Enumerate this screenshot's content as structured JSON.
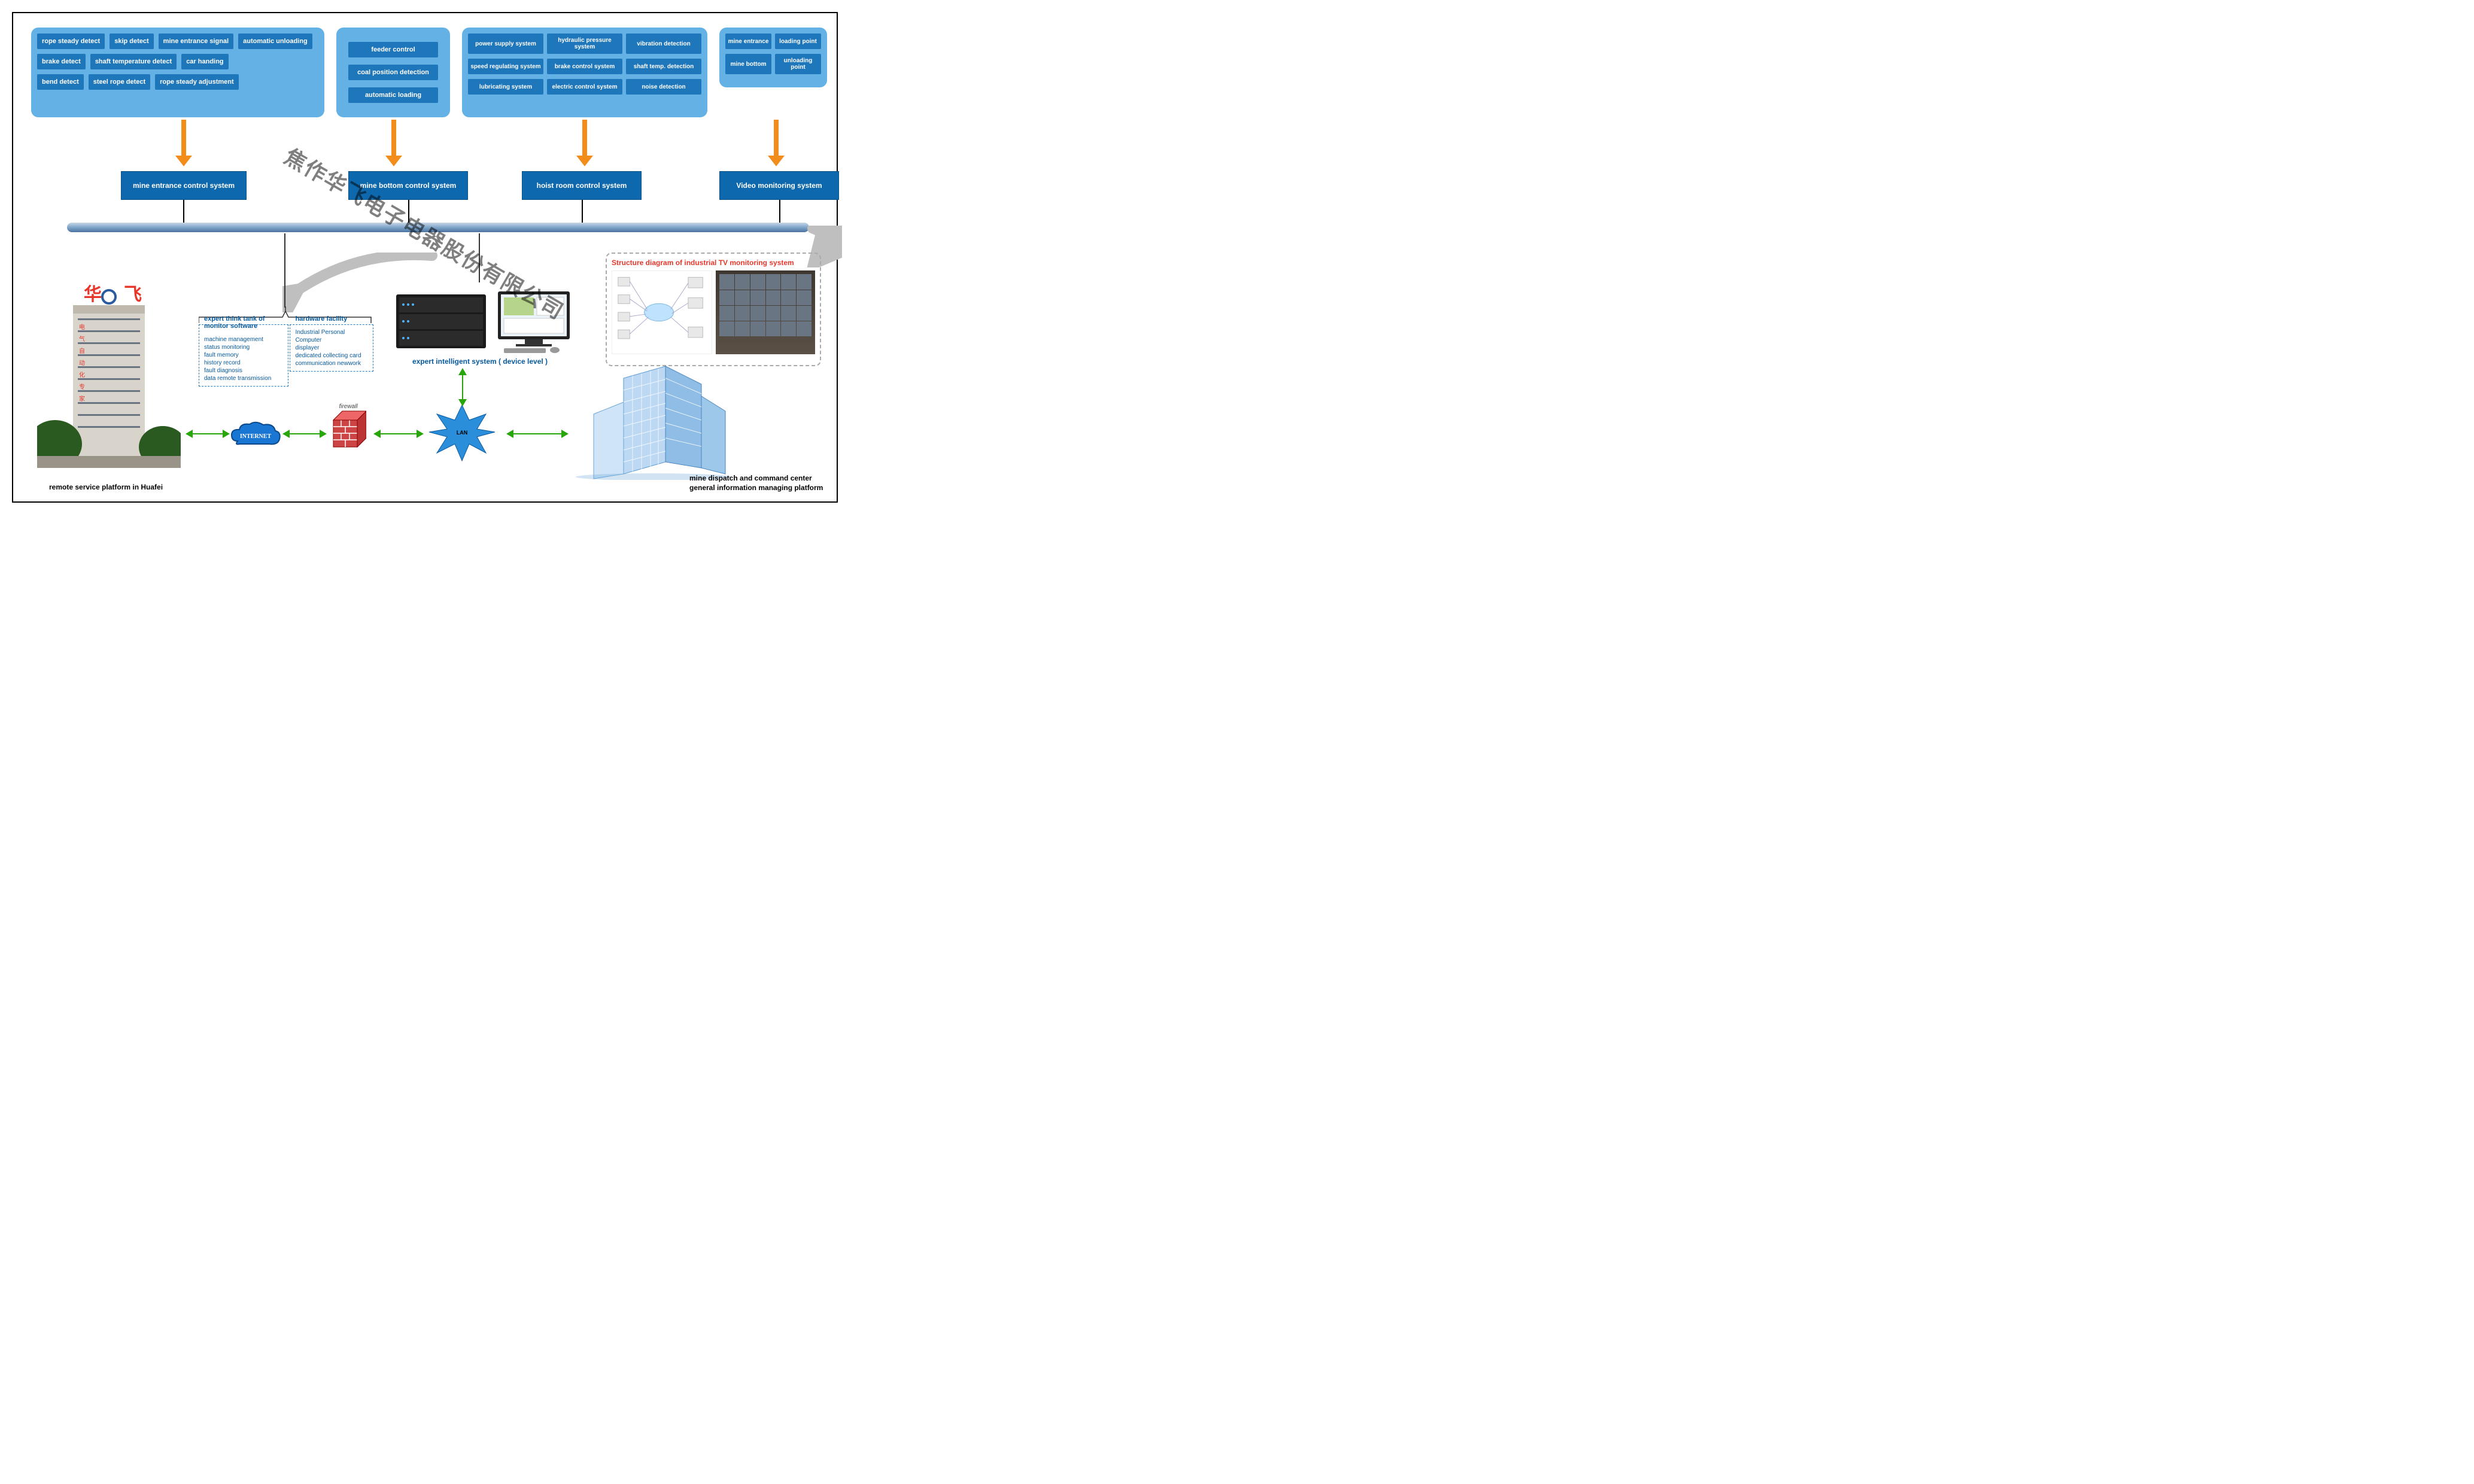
{
  "panel1": {
    "row1": [
      "rope steady detect",
      "skip detect",
      "mine entrance signal",
      "automatic unloading"
    ],
    "row2": [
      "brake detect",
      "shaft temperature detect",
      "car handing"
    ],
    "row3": [
      "bend detect",
      "steel rope detect",
      "rope steady adjustment"
    ]
  },
  "panel2": [
    "feeder control",
    "coal position detection",
    "automatic loading"
  ],
  "panel3": [
    "power supply system",
    "hydraulic pressure system",
    "vibration detection",
    "speed regulating system",
    "brake control system",
    "shaft temp. detection",
    "lubricating system",
    "electric control system",
    "noise detection"
  ],
  "panel4": [
    "mine entrance",
    "loading point",
    "mine bottom",
    "unloading point"
  ],
  "systems": {
    "s1": "mine entrance control system",
    "s2": "mine bottom control system",
    "s3": "hoist room control system",
    "s4": "Video monitoring system"
  },
  "dash": {
    "title1": "expert think tank of monitor software",
    "items1": [
      "machine management",
      "status monitoring",
      "fault memory",
      "history record",
      "fault diagnosis",
      "data remote transmission"
    ],
    "title2": "hardware facility",
    "items2": [
      "Industrial Personal Computer",
      "displayer",
      "dedicated collecting card",
      "communication newwork"
    ]
  },
  "expert_label": "expert intelligent system ( device level )",
  "tv_title": "Structure diagram of industrial TV monitoring system",
  "left_label": "remote service platform in Huafei",
  "right_label_l1": "mine dispatch and command center",
  "right_label_l2": "general information managing platform",
  "internet": "INTERNET",
  "lan": "LAN",
  "firewall": "firewall",
  "watermark": "焦作华飞电子电器股份有限公司"
}
